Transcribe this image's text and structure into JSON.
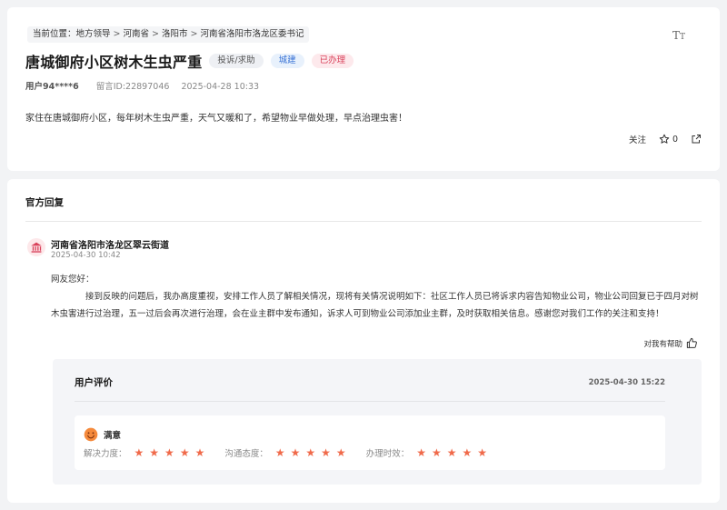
{
  "breadcrumb": {
    "prefix": "当前位置：",
    "items": [
      "地方领导",
      "河南省",
      "洛阳市",
      "河南省洛阳市洛龙区委书记"
    ],
    "separator": ">"
  },
  "toolbar": {
    "font_size_label": "TT"
  },
  "post": {
    "title": "唐城御府小区树木生虫严重",
    "tags": [
      "投诉/求助",
      "城建",
      "已办理"
    ],
    "user": "用户94****6",
    "message_id": "留言ID:22897046",
    "date": "2025-04-28 10:33",
    "content": "家住在唐城御府小区，每年树木生虫严重，天气又暖和了，希望物业早做处理，早点治理虫害！",
    "follow_label": "关注",
    "star_count": "0"
  },
  "reply": {
    "section_title": "官方回复",
    "org_name": "河南省洛阳市洛龙区翠云街道",
    "time": "2025-04-30 10:42",
    "greeting": "网友您好：",
    "body": "接到反映的问题后，我办高度重视，安排工作人员了解相关情况，现将有关情况说明如下：社区工作人员已将诉求内容告知物业公司，物业公司回复已于四月对树木虫害进行过治理，五一过后会再次进行治理，会在业主群中发布通知，诉求人可到物业公司添加业主群，及时获取相关信息。感谢您对我们工作的关注和支持！",
    "helpful_label": "对我有帮助"
  },
  "evaluation": {
    "title": "用户评价",
    "time": "2025-04-30 15:22",
    "satisfaction": "满意",
    "ratings": [
      {
        "label": "解决力度：",
        "stars": 5
      },
      {
        "label": "沟通态度：",
        "stars": 5
      },
      {
        "label": "办理时效：",
        "stars": 5
      }
    ]
  },
  "colors": {
    "accent_red": "#d9415a",
    "accent_blue": "#3b74d6",
    "star": "#f06a4a"
  }
}
